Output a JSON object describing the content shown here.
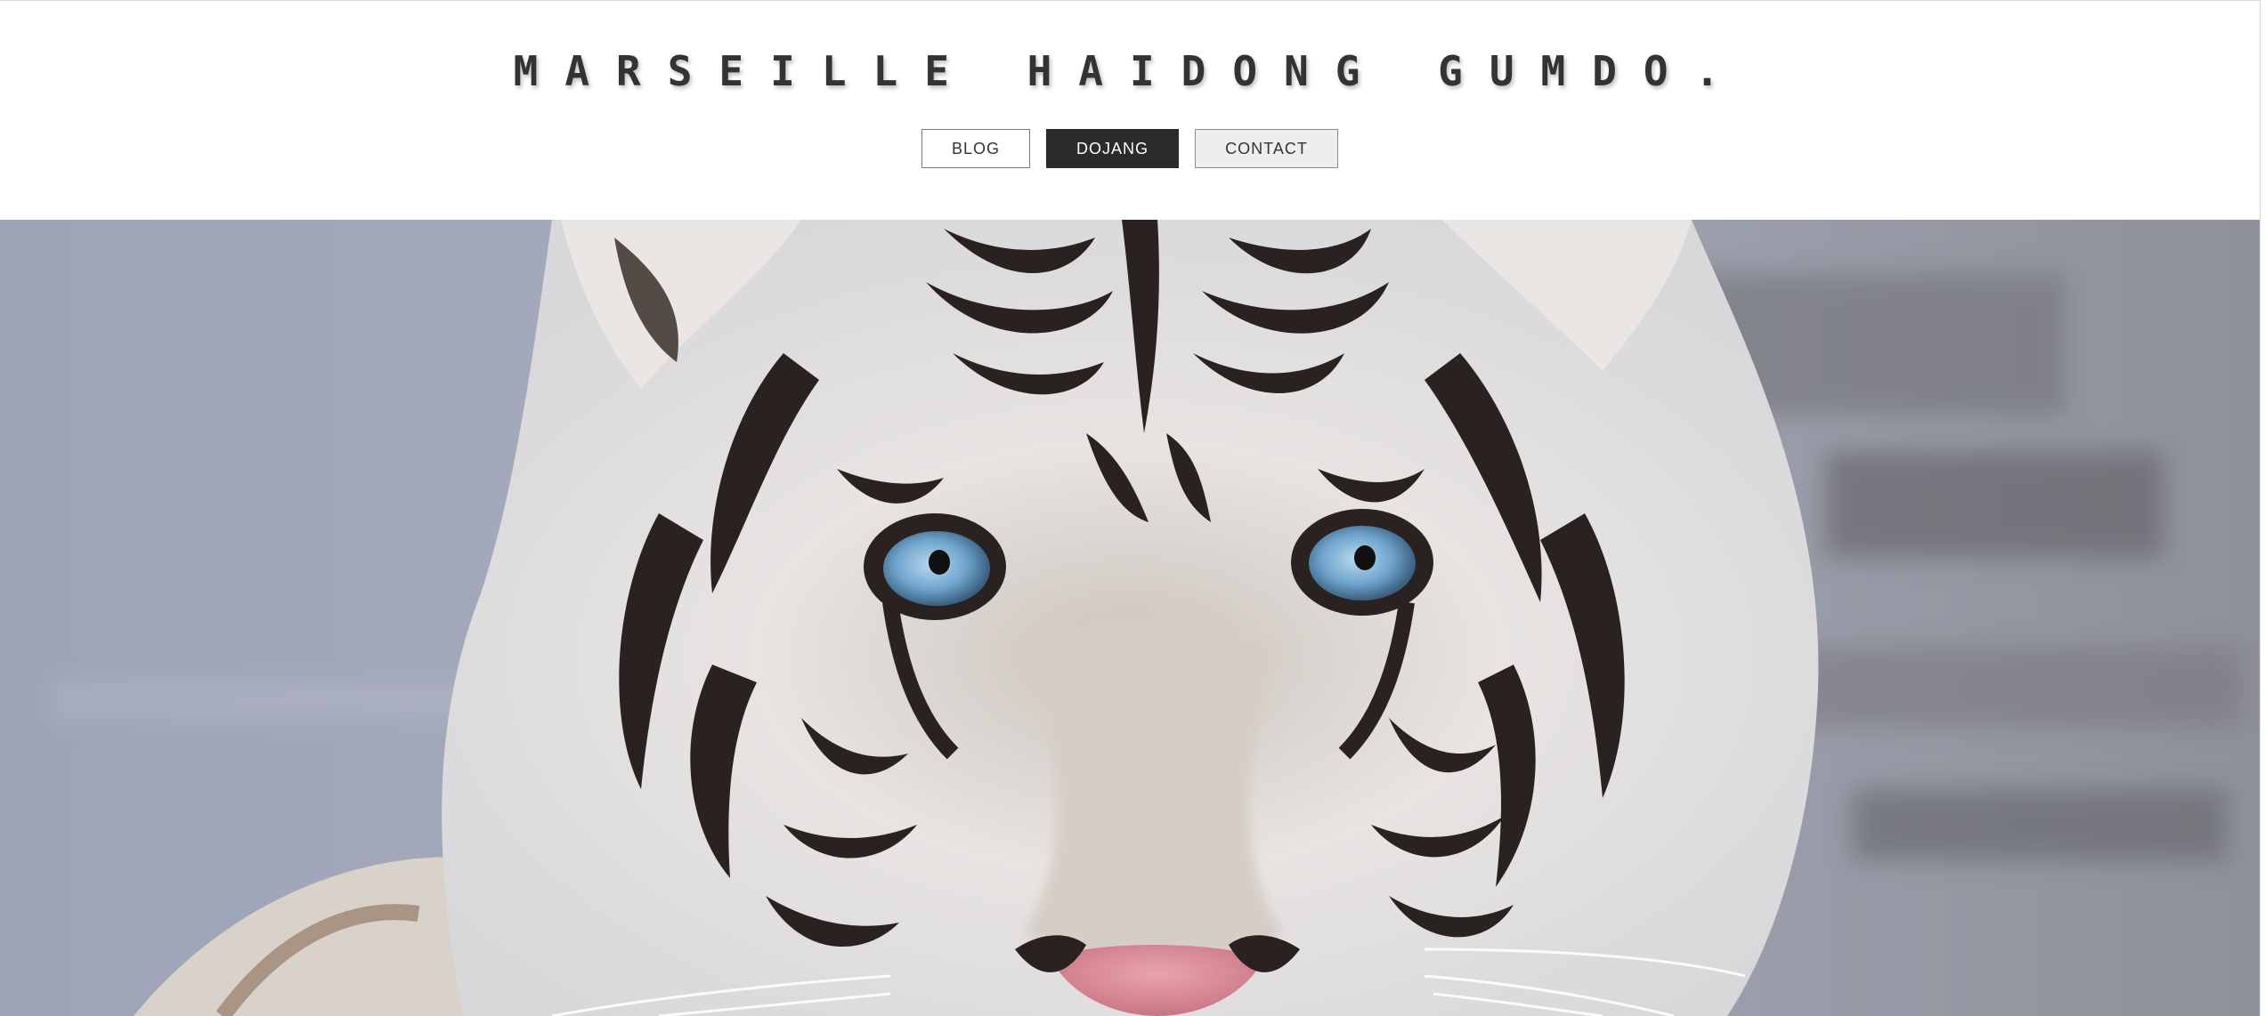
{
  "site": {
    "title": "MARSEILLE HAIDONG GUMDO."
  },
  "nav": {
    "items": [
      {
        "label": "BLOG",
        "active": false
      },
      {
        "label": "DOJANG",
        "active": true
      },
      {
        "label": "CONTACT",
        "active": false
      }
    ]
  },
  "hero": {
    "image": "white-tiger-face-photo",
    "colors": {
      "background": "#9aa0b2",
      "fur": "#e8e6e4",
      "stripes": "#2a2220",
      "eyes": "#7fb3d8",
      "nose": "#d98a98"
    }
  },
  "theme": {
    "accent_dark": "#2b2b2b",
    "text": "#333333"
  }
}
